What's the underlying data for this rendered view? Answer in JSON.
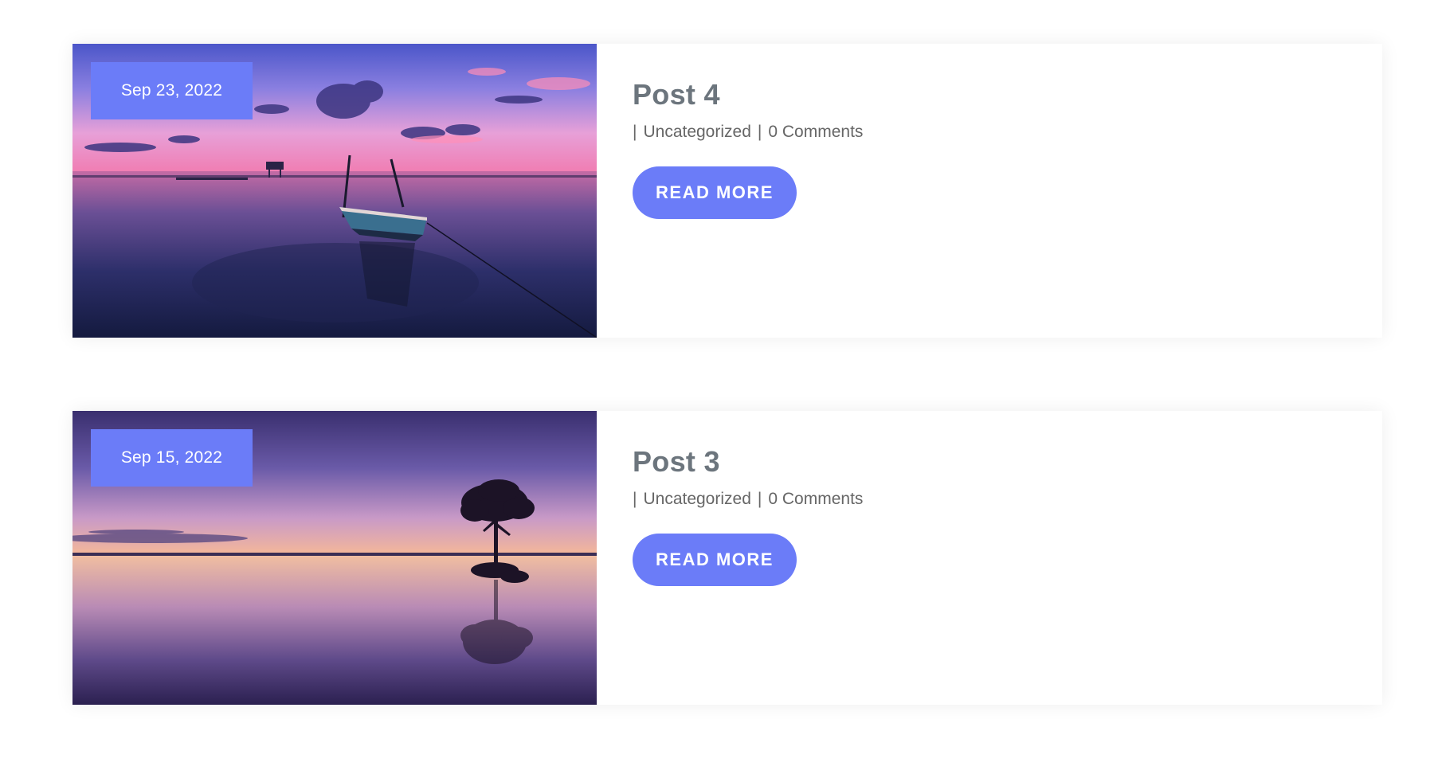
{
  "colors": {
    "accent": "#6b7cf8",
    "title": "#6c757d",
    "meta": "#666666"
  },
  "posts": [
    {
      "date": "Sep 23, 2022",
      "title": "Post 4",
      "meta_separator": "|",
      "category": "Uncategorized",
      "comments": "0 Comments",
      "button_label": "READ MORE"
    },
    {
      "date": "Sep 15, 2022",
      "title": "Post 3",
      "meta_separator": "|",
      "category": "Uncategorized",
      "comments": "0 Comments",
      "button_label": "READ MORE"
    }
  ]
}
